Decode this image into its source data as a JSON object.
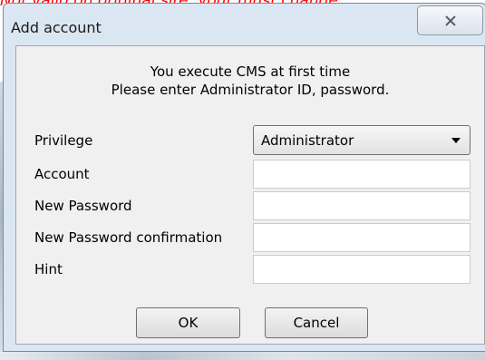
{
  "background": {
    "warning_text": "Not valid on original site, your must change…"
  },
  "dialog": {
    "title": "Add account",
    "close_glyph": "✕",
    "message": {
      "line1": "You execute CMS at first time",
      "line2": "Please enter Administrator ID, password."
    },
    "fields": {
      "privilege": {
        "label": "Privilege",
        "value": "Administrator"
      },
      "account": {
        "label": "Account",
        "value": ""
      },
      "new_password": {
        "label": "New Password",
        "value": ""
      },
      "confirm_password": {
        "label": "New Password confirmation",
        "value": ""
      },
      "hint": {
        "label": "Hint",
        "value": ""
      }
    },
    "buttons": {
      "ok": "OK",
      "cancel": "Cancel"
    }
  },
  "colors": {
    "window_frame": "#dbe6f3",
    "client_area": "#f0f0f0",
    "warning_text": "#ff0000"
  }
}
